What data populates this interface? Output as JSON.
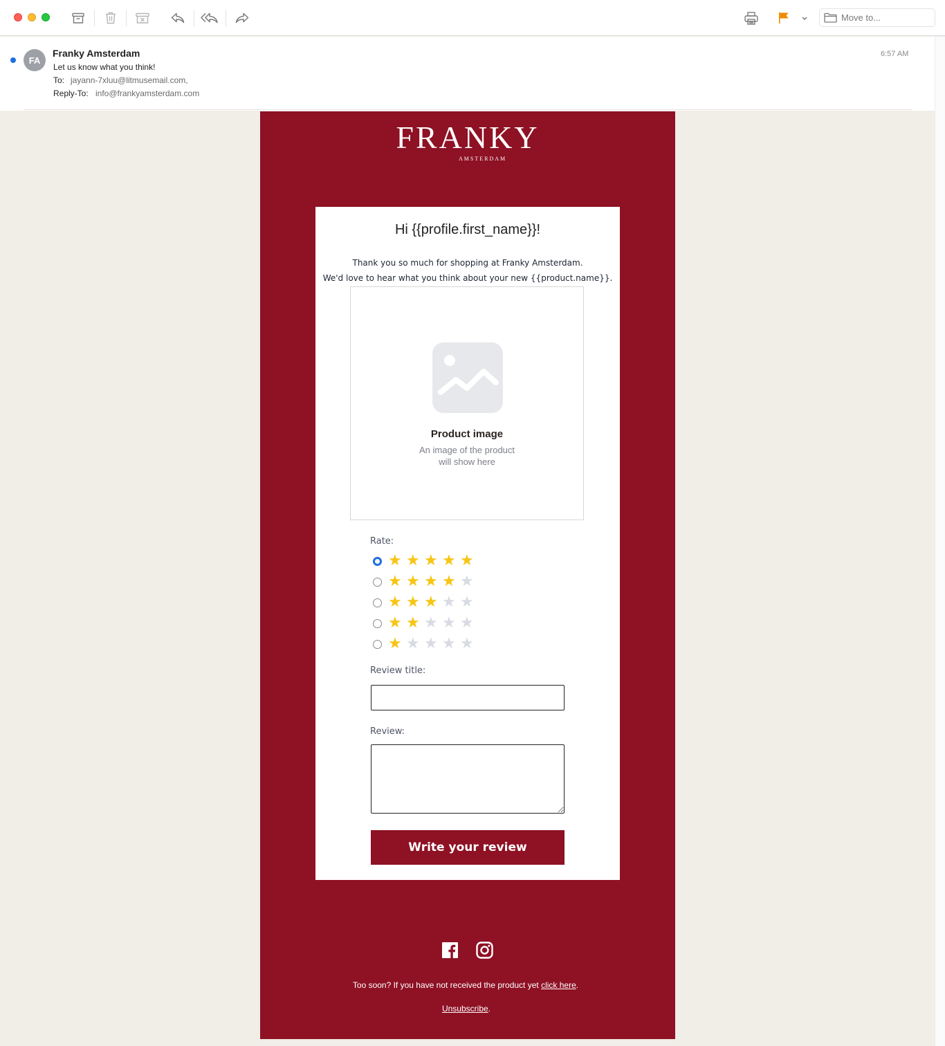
{
  "toolbar": {
    "move_to_label": "Move to...",
    "icons": [
      "archive-icon",
      "trash-icon",
      "junk-icon",
      "reply-icon",
      "reply-all-icon",
      "forward-icon",
      "print-icon",
      "flag-icon",
      "chevron-down-icon",
      "folder-icon"
    ],
    "flag_color": "#f08a00"
  },
  "message": {
    "avatar_initials": "FA",
    "sender": "Franky Amsterdam",
    "subject": "Let us know what you think!",
    "to_label": "To:",
    "to_value": "jayann-7xluu@litmusemail.com,",
    "reply_to_label": "Reply-To:",
    "reply_to_value": "info@frankyamsterdam.com",
    "time": "6:57 AM",
    "unread_color": "#1f6fe0"
  },
  "email": {
    "brand_color": "#8e1124",
    "logo_text": "FRANKY",
    "logo_subtext": "AMSTERDAM",
    "greeting": "Hi {{profile.first_name}}!",
    "intro_line1": "Thank you so much for shopping at Franky Amsterdam.",
    "intro_line2": "We'd love to hear what you think about your new {{product.name}}.",
    "product_image_title": "Product image",
    "product_image_desc1": "An image of the product",
    "product_image_desc2": "will show here",
    "rate_label": "Rate:",
    "rating_options": [
      {
        "stars": 5,
        "selected": true
      },
      {
        "stars": 4,
        "selected": false
      },
      {
        "stars": 3,
        "selected": false
      },
      {
        "stars": 2,
        "selected": false
      },
      {
        "stars": 1,
        "selected": false
      }
    ],
    "review_title_label": "Review title:",
    "review_title_value": "",
    "review_label": "Review:",
    "review_value": "",
    "submit_label": "Write your review",
    "social_icons": [
      "facebook-icon",
      "instagram-icon"
    ],
    "footer_text": "Too soon? If you have not received the product yet ",
    "footer_link": "click here",
    "footer_period": ".",
    "unsubscribe": "Unsubscribe",
    "unsubscribe_period": "."
  }
}
